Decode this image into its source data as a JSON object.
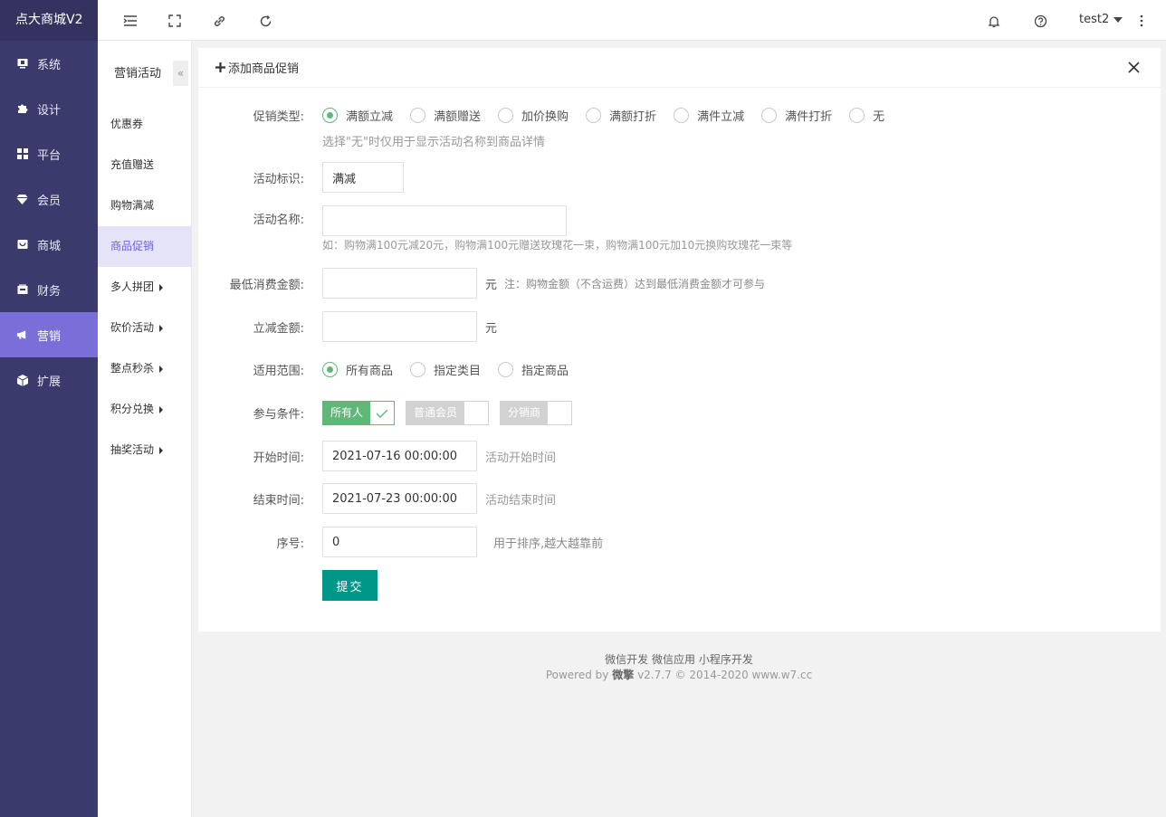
{
  "app": {
    "title": "点大商城V2"
  },
  "sidebar": {
    "items": [
      {
        "label": "系统",
        "icon": "monitor-icon"
      },
      {
        "label": "设计",
        "icon": "puzzle-icon"
      },
      {
        "label": "平台",
        "icon": "grid-icon"
      },
      {
        "label": "会员",
        "icon": "diamond-icon"
      },
      {
        "label": "商城",
        "icon": "shop-icon"
      },
      {
        "label": "财务",
        "icon": "wallet-icon"
      },
      {
        "label": "营销",
        "icon": "megaphone-icon",
        "active": true
      },
      {
        "label": "扩展",
        "icon": "cube-icon"
      }
    ]
  },
  "header": {
    "user": "test2"
  },
  "subnav": {
    "title": "营销活动",
    "collapse": "«",
    "items": [
      {
        "label": "优惠券"
      },
      {
        "label": "充值赠送"
      },
      {
        "label": "购物满减"
      },
      {
        "label": "商品促销",
        "active": true
      },
      {
        "label": "多人拼团",
        "caret": true
      },
      {
        "label": "砍价活动",
        "caret": true
      },
      {
        "label": "整点秒杀",
        "caret": true
      },
      {
        "label": "积分兑换",
        "caret": true
      },
      {
        "label": "抽奖活动",
        "caret": true
      }
    ]
  },
  "panel": {
    "title": "添加商品促销"
  },
  "form": {
    "promo_type": {
      "label": "促销类型:",
      "options": [
        "满额立减",
        "满额赠送",
        "加价换购",
        "满额打折",
        "满件立减",
        "满件打折",
        "无"
      ],
      "selected": "满额立减",
      "hint": "选择\"无\"时仅用于显示活动名称到商品详情"
    },
    "tag": {
      "label": "活动标识:",
      "value": "满减"
    },
    "name": {
      "label": "活动名称:",
      "value": "",
      "hint": "如：购物满100元减20元，购物满100元赠送玫瑰花一束，购物满100元加10元换购玫瑰花一束等"
    },
    "min_amount": {
      "label": "最低消费金额:",
      "value": "",
      "unit": "元",
      "hint": "注：购物金额（不含运费）达到最低消费金额才可参与"
    },
    "discount": {
      "label": "立减金额:",
      "value": "",
      "unit": "元"
    },
    "scope": {
      "label": "适用范围:",
      "options": [
        "所有商品",
        "指定类目",
        "指定商品"
      ],
      "selected": "所有商品"
    },
    "condition": {
      "label": "参与条件:",
      "toggles": [
        {
          "label": "所有人",
          "on": true
        },
        {
          "label": "普通会员",
          "on": false
        },
        {
          "label": "分销商",
          "on": false
        }
      ]
    },
    "start": {
      "label": "开始时间:",
      "value": "2021-07-16 00:00:00",
      "hint": "活动开始时间"
    },
    "end": {
      "label": "结束时间:",
      "value": "2021-07-23 00:00:00",
      "hint": "活动结束时间"
    },
    "order": {
      "label": "序号:",
      "value": "0",
      "hint": "用于排序,越大越靠前"
    },
    "submit": "提交"
  },
  "footer": {
    "links": [
      "微信开发",
      "微信应用",
      "小程序开发"
    ],
    "powered_prefix": "Powered by",
    "brand": "微擎",
    "suffix": "v2.7.7 © 2014-2020 www.w7.cc"
  },
  "colors": {
    "sidebar": "#3b3a6c",
    "active": "#7a6fd8",
    "green": "#5fb878",
    "submit": "#009688"
  }
}
